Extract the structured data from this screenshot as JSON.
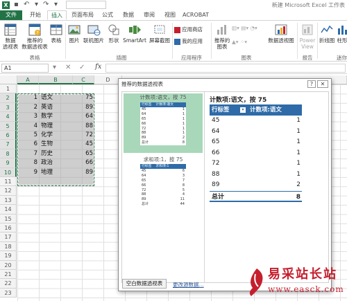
{
  "window": {
    "title": "新建 Microsoft Excel 工作表",
    "logo": "X"
  },
  "tabs": [
    "文件",
    "开始",
    "插入",
    "页面布局",
    "公式",
    "数据",
    "审阅",
    "视图",
    "ACROBAT"
  ],
  "active_tab": "插入",
  "ribbon": {
    "buttons": {
      "pivot": "数据\n透视表",
      "recommended_pivot": "推荐的\n数据透视表",
      "table": "表格",
      "picture": "图片",
      "online_picture": "联机图片",
      "shapes": "形状",
      "smartart": "SmartArt",
      "screenshot": "屏幕截图",
      "app_store": "应用商店",
      "my_apps": "我的应用",
      "recommended_charts": "推荐的\n图表",
      "pivot_chart": "数据透视图",
      "power_view": "Power\nView",
      "line": "折线图",
      "column": "柱形"
    },
    "groups": {
      "tables": "表格",
      "illustrations": "插图",
      "apps": "应用程序",
      "charts": "图表",
      "reports": "报告",
      "sparklines": "迷你"
    }
  },
  "formula_bar": {
    "name_box": "A1",
    "cancel": "✕",
    "enter": "✓",
    "fx": "fx",
    "value": ""
  },
  "sheet": {
    "columns": [
      "A",
      "B",
      "C",
      "D"
    ],
    "rows": [
      "1",
      "2",
      "3",
      "4",
      "5",
      "6",
      "7",
      "8",
      "9",
      "10",
      "11",
      "12",
      "13",
      "14",
      "15",
      "16",
      "17",
      "18",
      "19",
      "20",
      "21",
      "22",
      "23"
    ],
    "data": [
      {
        "n": "1",
        "subject": "语文",
        "score": "75"
      },
      {
        "n": "2",
        "subject": "英语",
        "score": "89"
      },
      {
        "n": "3",
        "subject": "数学",
        "score": "64"
      },
      {
        "n": "4",
        "subject": "物理",
        "score": "88"
      },
      {
        "n": "5",
        "subject": "化学",
        "score": "72"
      },
      {
        "n": "6",
        "subject": "生物",
        "score": "45"
      },
      {
        "n": "7",
        "subject": "历史",
        "score": "65"
      },
      {
        "n": "8",
        "subject": "政治",
        "score": "66"
      },
      {
        "n": "9",
        "subject": "地理",
        "score": "89"
      }
    ]
  },
  "dialog": {
    "title": "推荐的数据透视表",
    "help": "?",
    "close": "✕",
    "options": [
      {
        "title": "计数项:语文，按 75",
        "header_a": "行标签",
        "header_b": "计数项:语文",
        "rows": [
          [
            "45",
            "1"
          ],
          [
            "64",
            "1"
          ],
          [
            "65",
            "1"
          ],
          [
            "66",
            "1"
          ],
          [
            "72",
            "1"
          ],
          [
            "88",
            "1"
          ],
          [
            "89",
            "2"
          ],
          [
            "总计",
            "8"
          ]
        ]
      },
      {
        "title": "求和项:1，按 75",
        "header_a": "行标签",
        "header_b": "求和项:1",
        "rows": [
          [
            "45",
            "6"
          ],
          [
            "64",
            "3"
          ],
          [
            "65",
            "7"
          ],
          [
            "66",
            "8"
          ],
          [
            "72",
            "5"
          ],
          [
            "88",
            "4"
          ],
          [
            "89",
            "11"
          ],
          [
            "总计",
            "44"
          ]
        ]
      }
    ],
    "preview": {
      "title": "计数项:语文，按 75",
      "header_label": "行标签",
      "header_value": "计数项:语文",
      "rows": [
        {
          "label": "45",
          "value": "1"
        },
        {
          "label": "64",
          "value": "1"
        },
        {
          "label": "65",
          "value": "1"
        },
        {
          "label": "66",
          "value": "1"
        },
        {
          "label": "72",
          "value": "1"
        },
        {
          "label": "88",
          "value": "1"
        },
        {
          "label": "89",
          "value": "2"
        }
      ],
      "total_label": "总计",
      "total_value": "8"
    },
    "blank_button": "空白数据透视表",
    "change_source_link": "更改源数据..."
  },
  "watermark": {
    "name": "易采站长站",
    "url": "www.easck.com"
  },
  "colors": {
    "excel_green": "#217346",
    "pivot_blue": "#2e6ba8",
    "selected_option": "#a8d8b9",
    "watermark_red": "#c51f2e"
  }
}
